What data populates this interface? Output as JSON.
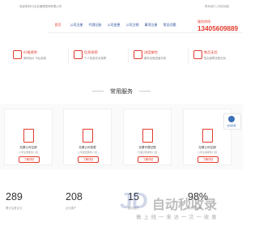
{
  "topbar": {
    "company": "欢迎来到XX企业管理咨询有限公司",
    "links": "联系我们 | 网站地图"
  },
  "nav": {
    "items": [
      "首页",
      "公司注册",
      "代理记账",
      "公司变更",
      "公司注销",
      "事项注册",
      "常见问题"
    ]
  },
  "hotline": {
    "label": "服务热线",
    "number": "13405609889"
  },
  "features": [
    {
      "title": "价格透明",
      "desc": "明码标价 不乱收费"
    },
    {
      "title": "信息保密",
      "desc": "个人信息安全保障"
    },
    {
      "title": "进度掌控",
      "desc": "服务全程进度可查"
    },
    {
      "title": "售后无忧",
      "desc": "售后保障全程无忧"
    }
  ],
  "services": {
    "title": "常用服务",
    "cards": [
      {
        "title": "无锡公司注册",
        "desc": "公司注册服务介绍",
        "button": "了解详情"
      },
      {
        "title": "无锡公司变更",
        "desc": "公司变更服务介绍",
        "button": "了解详情"
      },
      {
        "title": "无锡代理记账",
        "desc": "代理记账服务介绍",
        "button": "了解详情"
      },
      {
        "title": "无锡公司注销",
        "desc": "公司注销服务介绍",
        "button": "了解详情"
      }
    ]
  },
  "chat": {
    "label": "在线客服"
  },
  "stats": [
    {
      "value": "289",
      "label": "累计注册企业"
    },
    {
      "value": "208",
      "label": "企业客户"
    },
    {
      "value": "15",
      "label": "团队成员"
    },
    {
      "value": "98%",
      "label": "服务好评率"
    }
  ],
  "watermark": {
    "logo": "JD",
    "title": "自动秒收录",
    "subtitle": "做 上 线 一 来 访 一 次 一 收 录"
  }
}
